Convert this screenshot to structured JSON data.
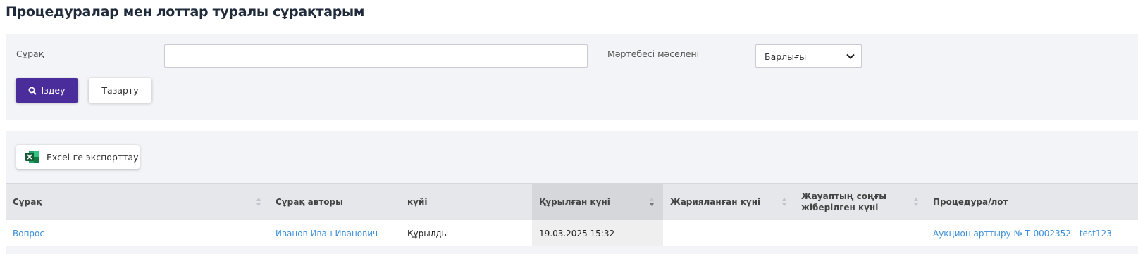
{
  "page": {
    "title": "Процедуралар мен лоттар туралы сұрақтарым"
  },
  "filters": {
    "question_label": "Сұрақ",
    "question_value": "",
    "status_label": "Мәртебесі мәселені",
    "status_selected": "Барлығы",
    "search_button": "Іздеу",
    "clear_button": "Тазарту"
  },
  "toolbar": {
    "export_button": "Excel-ге экспорттау"
  },
  "table": {
    "columns": [
      "Сұрақ",
      "Сұрақ авторы",
      "күйі",
      "Құрылған күні",
      "Жарияланған күні",
      "Жауаптың соңғы жіберілген күні",
      "Процедура/лот"
    ],
    "rows": [
      {
        "question": "Вопрос",
        "author": "Иванов Иван Иванович",
        "status": "Құрылды",
        "created": "19.03.2025 15:32",
        "published": "",
        "last_answer": "",
        "procedure": "Аукцион арттыру № Т-0002352 - test123"
      }
    ]
  },
  "colors": {
    "primary": "#4a2c9b",
    "link": "#3b8fd8",
    "panel": "#f3f4f8",
    "excel": "#1d7044"
  },
  "icons": {
    "search": "search-icon",
    "chevron": "chevron-down-icon",
    "excel": "excel-icon",
    "sort": "sort-icon"
  }
}
